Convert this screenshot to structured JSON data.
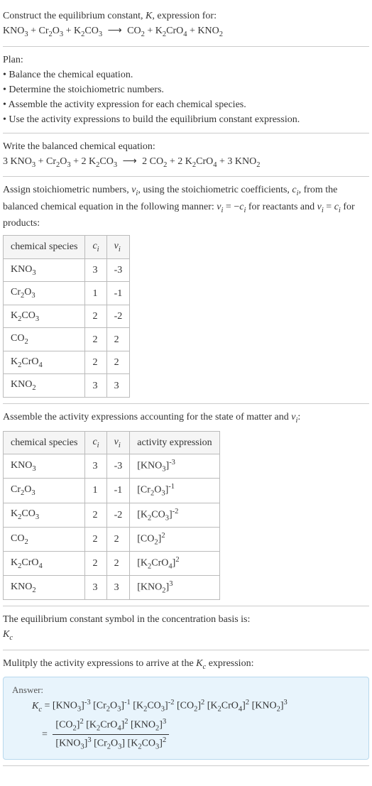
{
  "intro": {
    "line1": "Construct the equilibrium constant, K, expression for:",
    "equation": "KNO₃ + Cr₂O₃ + K₂CO₃  ⟶  CO₂ + K₂CrO₄ + KNO₂"
  },
  "plan": {
    "title": "Plan:",
    "items": [
      "• Balance the chemical equation.",
      "• Determine the stoichiometric numbers.",
      "• Assemble the activity expression for each chemical species.",
      "• Use the activity expressions to build the equilibrium constant expression."
    ]
  },
  "balanced": {
    "title": "Write the balanced chemical equation:",
    "equation": "3 KNO₃ + Cr₂O₃ + 2 K₂CO₃  ⟶  2 CO₂ + 2 K₂CrO₄ + 3 KNO₂"
  },
  "stoich": {
    "intro": "Assign stoichiometric numbers, νᵢ, using the stoichiometric coefficients, cᵢ, from the balanced chemical equation in the following manner: νᵢ = −cᵢ for reactants and νᵢ = cᵢ for products:",
    "headers": [
      "chemical species",
      "cᵢ",
      "νᵢ"
    ],
    "rows": [
      {
        "species": "KNO₃",
        "c": "3",
        "v": "-3"
      },
      {
        "species": "Cr₂O₃",
        "c": "1",
        "v": "-1"
      },
      {
        "species": "K₂CO₃",
        "c": "2",
        "v": "-2"
      },
      {
        "species": "CO₂",
        "c": "2",
        "v": "2"
      },
      {
        "species": "K₂CrO₄",
        "c": "2",
        "v": "2"
      },
      {
        "species": "KNO₂",
        "c": "3",
        "v": "3"
      }
    ]
  },
  "activity": {
    "intro": "Assemble the activity expressions accounting for the state of matter and νᵢ:",
    "headers": [
      "chemical species",
      "cᵢ",
      "νᵢ",
      "activity expression"
    ],
    "rows": [
      {
        "species": "KNO₃",
        "c": "3",
        "v": "-3",
        "expr": "[KNO₃]⁻³"
      },
      {
        "species": "Cr₂O₃",
        "c": "1",
        "v": "-1",
        "expr": "[Cr₂O₃]⁻¹"
      },
      {
        "species": "K₂CO₃",
        "c": "2",
        "v": "-2",
        "expr": "[K₂CO₃]⁻²"
      },
      {
        "species": "CO₂",
        "c": "2",
        "v": "2",
        "expr": "[CO₂]²"
      },
      {
        "species": "K₂CrO₄",
        "c": "2",
        "v": "2",
        "expr": "[K₂CrO₄]²"
      },
      {
        "species": "KNO₂",
        "c": "3",
        "v": "3",
        "expr": "[KNO₂]³"
      }
    ]
  },
  "eqconst": {
    "line1": "The equilibrium constant symbol in the concentration basis is:",
    "symbol": "K_c"
  },
  "multiply": {
    "line": "Mulitply the activity expressions to arrive at the K_c expression:"
  },
  "answer": {
    "label": "Answer:",
    "line1_lhs": "K_c = ",
    "line1_rhs": "[KNO₃]⁻³ [Cr₂O₃]⁻¹ [K₂CO₃]⁻² [CO₂]² [K₂CrO₄]² [KNO₂]³",
    "line2_eq": "= ",
    "frac_num": "[CO₂]² [K₂CrO₄]² [KNO₂]³",
    "frac_den": "[KNO₃]³ [Cr₂O₃] [K₂CO₃]²"
  }
}
